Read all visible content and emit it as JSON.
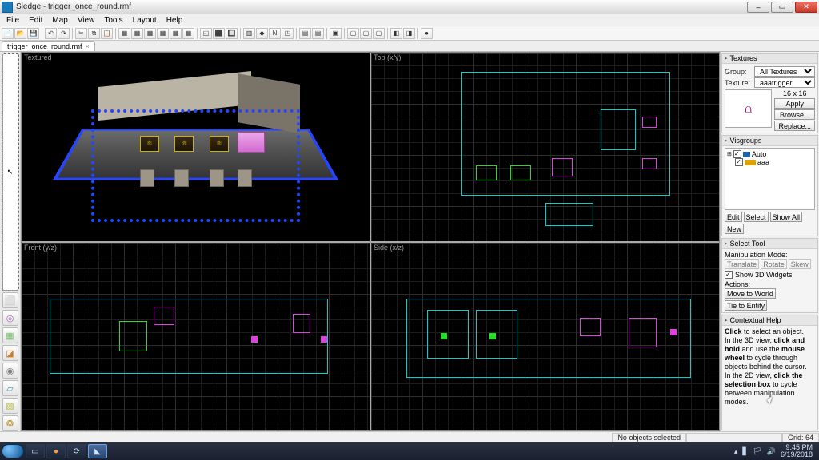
{
  "window": {
    "app_name": "Sledge",
    "document": "trigger_once_round.rmf",
    "title": "Sledge - trigger_once_round.rmf",
    "min_icon": "–",
    "max_icon": "▭",
    "close_icon": "✕"
  },
  "menu": {
    "file": "File",
    "edit": "Edit",
    "map": "Map",
    "view": "View",
    "tools": "Tools",
    "layout": "Layout",
    "help": "Help"
  },
  "toolbar_icons": [
    "📄",
    "📂",
    "💾",
    "|",
    "↶",
    "↷",
    "|",
    "✂",
    "⧉",
    "📋",
    "|",
    "▦",
    "▦",
    "▦",
    "▦",
    "▦",
    "▦",
    "|",
    "◰",
    "⬛",
    "🔲",
    "|",
    "▥",
    "◆",
    "N",
    "◳",
    "|",
    "▤",
    "▤",
    "|",
    "▣",
    "|",
    "▢",
    "▢",
    "▢",
    "|",
    "◧",
    "◨",
    "|",
    "●"
  ],
  "tab": {
    "name": "trigger_once_round.rmf",
    "close": "×"
  },
  "left_tools": [
    {
      "icon": "↖",
      "name": "select-tool",
      "color": ""
    },
    {
      "icon": "⬜",
      "name": "camera-tool",
      "color": "#5aa8e6"
    },
    {
      "icon": "◎",
      "name": "entity-tool",
      "color": "#b060c0"
    },
    {
      "icon": "▦",
      "name": "block-tool",
      "color": "#7ac070"
    },
    {
      "icon": "◪",
      "name": "texture-app-tool",
      "color": "#c88030"
    },
    {
      "icon": "◉",
      "name": "decal-tool",
      "color": "#808080"
    },
    {
      "icon": "▱",
      "name": "clip-tool",
      "color": "#4aa0c0"
    },
    {
      "icon": "▧",
      "name": "vertex-tool",
      "color": "#b8c040"
    },
    {
      "icon": "❂",
      "name": "path-tool",
      "color": "#c09030"
    }
  ],
  "viewport_labels": {
    "tl": "Textured",
    "tr": "Top (x/y)",
    "bl": "Front (y/z)",
    "br": "Side (x/z)"
  },
  "textures_panel": {
    "title": "Textures",
    "group_label": "Group:",
    "group_value": "All Textures",
    "texture_label": "Texture:",
    "texture_value": "aaatrigger",
    "size": "16 x 16",
    "preview_glyph": "⩍",
    "apply": "Apply",
    "browse": "Browse...",
    "replace": "Replace..."
  },
  "visgroups_panel": {
    "title": "Visgroups",
    "auto": "Auto",
    "aaa": "aaa",
    "edit": "Edit",
    "select": "Select",
    "showall": "Show All",
    "new": "New"
  },
  "select_tool_panel": {
    "title": "Select Tool",
    "manip_label": "Manipulation Mode:",
    "translate": "Translate",
    "rotate": "Rotate",
    "skew": "Skew",
    "show3d": "Show 3D Widgets",
    "actions_label": "Actions:",
    "move_world": "Move to World",
    "tie_entity": "Tie to Entity"
  },
  "help_panel": {
    "title": "Contextual Help",
    "line1a": "Click",
    "line1b": " to select an object.",
    "line2a": "In the 3D view, ",
    "line2b": "click and hold",
    "line2c": " and use the ",
    "line3a": "mouse wheel",
    "line3b": " to cycle through objects behind the cursor.",
    "line4a": "In the 2D view, ",
    "line4b": "click the selection box",
    "line4c": " to cycle between manipulation modes."
  },
  "status": {
    "selection": "No objects selected",
    "grid": "Grid: 64"
  },
  "taskbar": {
    "time": "9:45 PM",
    "date": "6/19/2018",
    "tray_icons": [
      "▴",
      "▋",
      "🏳",
      "🔊"
    ]
  }
}
